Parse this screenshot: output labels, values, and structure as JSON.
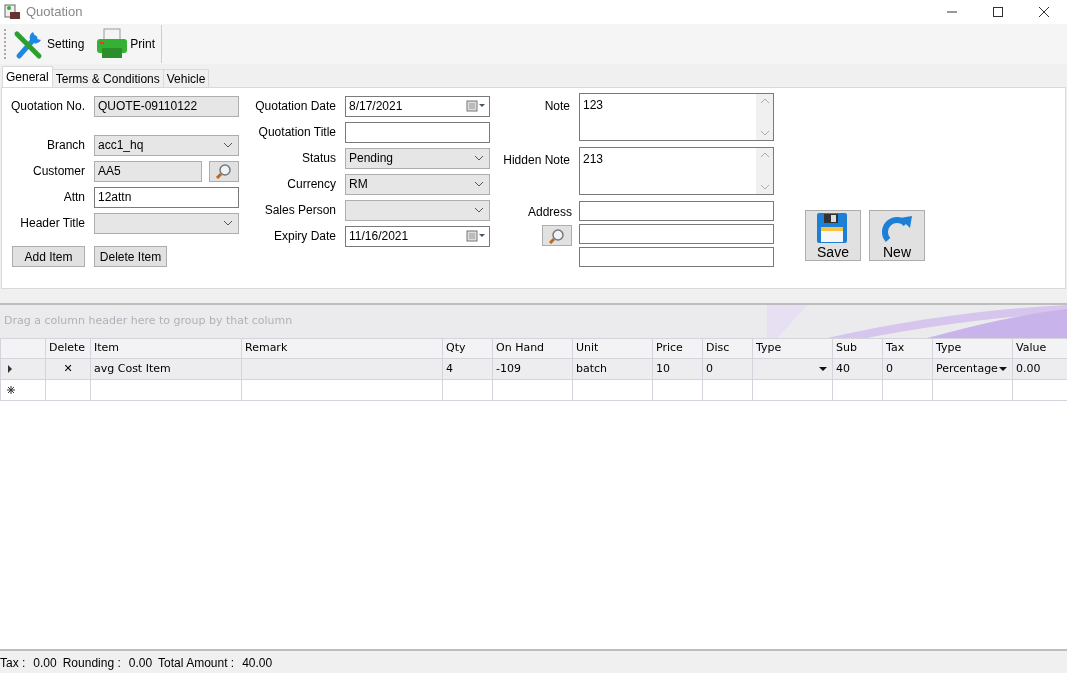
{
  "window": {
    "title": "Quotation"
  },
  "toolbar": [
    {
      "label": "Setting",
      "kind": "setting"
    },
    {
      "label": "Print",
      "kind": "print"
    }
  ],
  "tabs": [
    {
      "label": "General",
      "selected": true
    },
    {
      "label": "Terms & Conditions",
      "selected": false
    },
    {
      "label": "Vehicle",
      "selected": false
    }
  ],
  "form": {
    "columns": [
      [
        {
          "label": "Quotation No.",
          "value": "QUOTE-09110122",
          "kind": "text",
          "readonly": true
        },
        {
          "label": "Branch",
          "value": "acc1_hq",
          "kind": "combo",
          "readonly": true
        },
        {
          "label": "Customer",
          "value": "AA5",
          "kind": "lookup",
          "readonly": true
        },
        {
          "label": "Attn",
          "value": "12attn",
          "kind": "text",
          "readonly": false
        },
        {
          "label": "Header Title",
          "kind": "combo",
          "readonly": true
        }
      ],
      [
        {
          "label": "Quotation Date",
          "value": "8/17/2021",
          "kind": "date",
          "readonly": false
        },
        {
          "label": "Quotation Title",
          "kind": "text",
          "readonly": false
        },
        {
          "label": "Status",
          "value": "Pending",
          "kind": "combo",
          "readonly": true
        },
        {
          "label": "Currency",
          "value": "RM",
          "kind": "combo",
          "readonly": true
        },
        {
          "label": "Sales Person",
          "kind": "combo",
          "readonly": true
        },
        {
          "label": "Expiry Date",
          "value": "11/16/2021",
          "kind": "date",
          "readonly": false
        }
      ],
      [
        {
          "label": "Note",
          "value": "123",
          "kind": "memo"
        },
        {
          "label": "Hidden Note",
          "value": "213",
          "kind": "memo"
        },
        {
          "label": "Address",
          "kind": "address"
        }
      ]
    ]
  },
  "item_buttons": [
    "Add Item",
    "Delete Item"
  ],
  "action_buttons": [
    {
      "label": "Save",
      "kind": "save"
    },
    {
      "label": "New",
      "kind": "new"
    }
  ],
  "grid": {
    "group_hint": "Drag a column header here to group by that column",
    "columns": [
      {
        "label": "Delete",
        "kind": "icon"
      },
      {
        "label": "Item",
        "kind": "text"
      },
      {
        "label": "Remark",
        "kind": "text"
      },
      {
        "label": "Qty",
        "kind": "text"
      },
      {
        "label": "On Hand",
        "kind": "text"
      },
      {
        "label": "Unit",
        "kind": "text"
      },
      {
        "label": "Price",
        "kind": "text"
      },
      {
        "label": "Disc",
        "kind": "text"
      },
      {
        "label": "Type",
        "kind": "combo"
      },
      {
        "label": "Sub",
        "kind": "text"
      },
      {
        "label": "Tax",
        "kind": "text"
      },
      {
        "label": "Type",
        "kind": "combo"
      },
      {
        "label": "Value",
        "kind": "text"
      }
    ],
    "rows": [
      {
        "kind": "data",
        "selected": true,
        "cells": [
          "✕",
          "avg Cost Item",
          null,
          "4",
          "-109",
          "batch",
          "10",
          "0",
          null,
          "40",
          "0",
          "Percentage",
          "0.00"
        ]
      },
      {
        "kind": "new",
        "selected": false
      }
    ]
  },
  "status_bar": [
    {
      "label": "Tax :",
      "value": "0.00"
    },
    {
      "label": "Rounding :",
      "value": "0.00"
    },
    {
      "label": "Total Amount :",
      "value": "40.00"
    }
  ]
}
